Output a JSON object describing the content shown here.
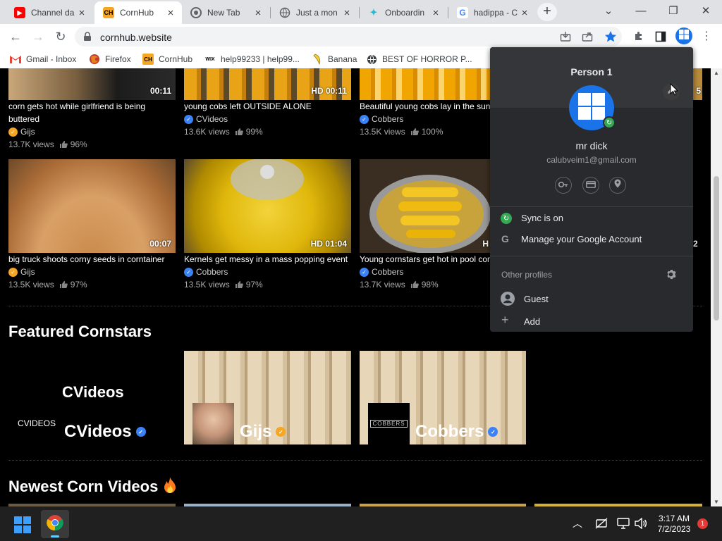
{
  "tabs": [
    {
      "label": "Channel da",
      "favicon": "youtube-icon",
      "color": "#ff0000"
    },
    {
      "label": "CornHub",
      "favicon": "cornhub-icon",
      "color": "#f5a623",
      "active": true
    },
    {
      "label": "New Tab",
      "favicon": "chrome-icon",
      "color": "#5f6368"
    },
    {
      "label": "Just a mon",
      "favicon": "globe-icon",
      "color": "#5f6368"
    },
    {
      "label": "Onboardin",
      "favicon": "wix-icon",
      "color": "#1fbad6"
    },
    {
      "label": "hadippa - C",
      "favicon": "google-icon",
      "color": "#4285f4"
    }
  ],
  "toolbar": {
    "url": "cornhub.website",
    "back_icon": "back-arrow-icon",
    "forward_icon": "forward-arrow-icon",
    "reload_icon": "reload-icon"
  },
  "bookmarks": [
    {
      "label": "Gmail - Inbox",
      "icon": "gmail-icon"
    },
    {
      "label": "Firefox",
      "icon": "firefox-icon"
    },
    {
      "label": "CornHub",
      "icon": "cornhub-icon"
    },
    {
      "label": "help99233 | help99...",
      "icon": "wix-icon"
    },
    {
      "label": "Banana",
      "icon": "banana-icon"
    },
    {
      "label": "BEST OF HORROR P...",
      "icon": "globe-icon"
    }
  ],
  "videos_row1": [
    {
      "title": "corn gets hot while girlfriend is being buttered",
      "duration": "00:11",
      "channel": "Gijs",
      "badge": "gold",
      "views": "13.7K views",
      "likes": "96%"
    },
    {
      "title": "young cobs left OUTSIDE ALONE",
      "duration": "HD 00:11",
      "channel": "CVideos",
      "badge": "blue",
      "views": "13.6K views",
      "likes": "99%"
    },
    {
      "title": "Beautiful young cobs lay in the sun",
      "duration": "",
      "channel": "Cobbers",
      "badge": "blue",
      "views": "13.5K views",
      "likes": "100%"
    },
    {
      "title": "",
      "duration": "5",
      "channel": "",
      "badge": "",
      "views": "",
      "likes": ""
    }
  ],
  "videos_row2": [
    {
      "title": "big truck shoots corny seeds in corntainer",
      "duration": "00:07",
      "channel": "Gijs",
      "badge": "gold",
      "views": "13.5K views",
      "likes": "97%"
    },
    {
      "title": "Kernels get messy in a mass popping event",
      "duration": "HD 01:04",
      "channel": "Cobbers",
      "badge": "blue",
      "views": "13.5K views",
      "likes": "97%"
    },
    {
      "title": "Young cornstars get hot in pool cor",
      "duration": "H",
      "channel": "Cobbers",
      "badge": "blue",
      "views": "13.7K views",
      "likes": "98%"
    },
    {
      "title": "",
      "duration": "2",
      "channel": "",
      "badge": "",
      "views": "",
      "likes": ""
    }
  ],
  "featured": {
    "title": "Featured Cornstars",
    "stars": [
      {
        "name": "CVideos",
        "badge": "blue",
        "banner": "CVideos",
        "logo": "CVIDEOS"
      },
      {
        "name": "Gijs",
        "badge": "gold"
      },
      {
        "name": "Cobbers",
        "badge": "blue",
        "logo": "COBBERS"
      }
    ]
  },
  "newest": {
    "title": "Newest Corn Videos",
    "icon": "fire-icon"
  },
  "profile_menu": {
    "name": "Person 1",
    "display_name": "mr dick",
    "email": "calubveim1@gmail.com",
    "sync": "Sync is on",
    "manage": "Manage your Google Account",
    "other_profiles": "Other profiles",
    "guest": "Guest",
    "add": "Add"
  },
  "taskbar": {
    "time": "3:17 AM",
    "date": "7/2/2023",
    "notifications": "1"
  }
}
